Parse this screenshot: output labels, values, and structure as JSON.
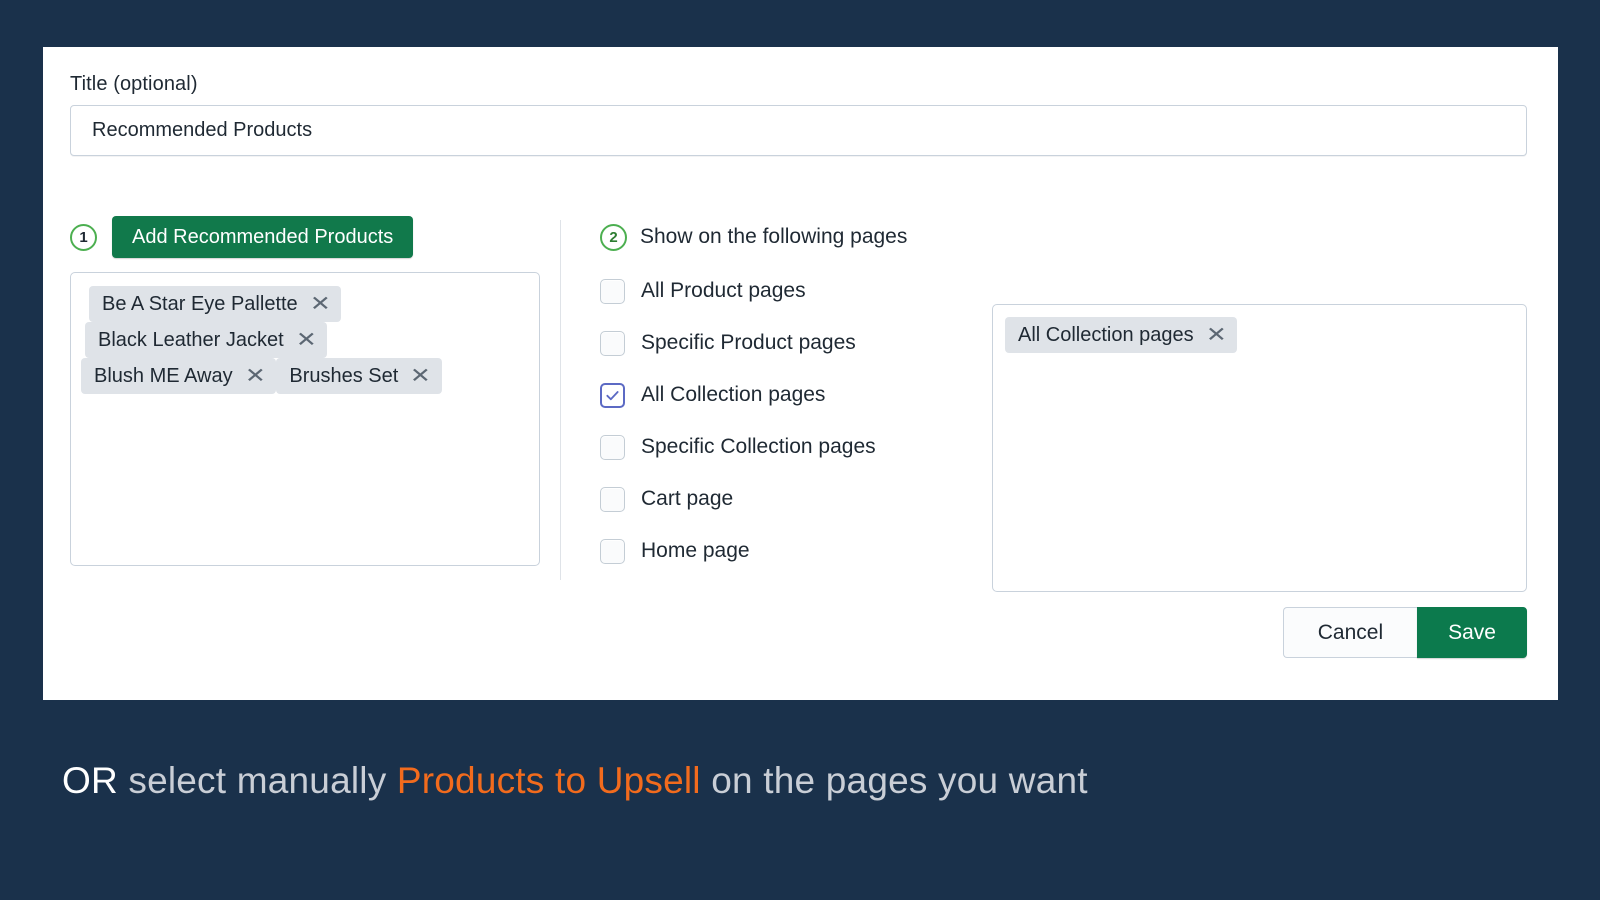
{
  "theme": {
    "background": "#1a314b",
    "card_background": "#ffffff",
    "primary_green": "#0c7a4d",
    "badge_green": "#4caf50",
    "checkbox_checked": "#5c6ac4",
    "chip_background": "#dfe3e8",
    "accent_orange": "#f26b1d"
  },
  "form": {
    "title_label": "Title (optional)",
    "title_value": "Recommended Products",
    "title_placeholder": "Title (optional)"
  },
  "step1": {
    "badge": "1",
    "button_label": "Add Recommended Products",
    "chips": [
      {
        "label": "Be A Star Eye Pallette",
        "remove_icon": "close-icon"
      },
      {
        "label": "Black Leather Jacket",
        "remove_icon": "close-icon"
      },
      {
        "label": "Blush ME Away",
        "remove_icon": "close-icon"
      },
      {
        "label": "Brushes Set",
        "remove_icon": "close-icon"
      }
    ]
  },
  "step2": {
    "badge": "2",
    "heading": "Show on the following pages",
    "options": [
      {
        "label": "All Product pages",
        "checked": false
      },
      {
        "label": "Specific Product pages",
        "checked": false
      },
      {
        "label": "All Collection pages",
        "checked": true
      },
      {
        "label": "Specific Collection pages",
        "checked": false
      },
      {
        "label": "Cart page",
        "checked": false
      },
      {
        "label": "Home page",
        "checked": false
      }
    ]
  },
  "selected_pages": {
    "chips": [
      {
        "label": "All Collection pages",
        "remove_icon": "close-icon"
      }
    ]
  },
  "footer": {
    "cancel_label": "Cancel",
    "save_label": "Save"
  },
  "caption": {
    "part_or": "OR",
    "part_one": " select manually ",
    "part_accent": "Products to Upsell",
    "part_two": " on the pages you want"
  }
}
